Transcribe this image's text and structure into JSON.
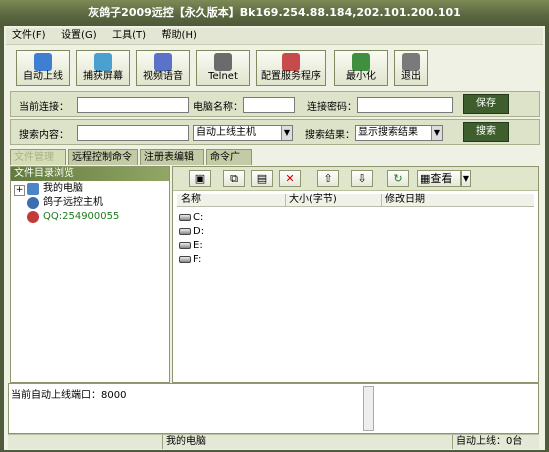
{
  "title": "灰鸽子2009远控【永久版本】Bk169.254.88.184,202.101.200.101",
  "menu": [
    "文件(F)",
    "设置(G)",
    "工具(T)",
    "帮助(H)"
  ],
  "toolbar": [
    {
      "label": "自动上线",
      "icon": "auto-online-icon",
      "color": "#3e7fd1"
    },
    {
      "label": "捕获屏幕",
      "icon": "capture-screen-icon",
      "color": "#4aa0cf"
    },
    {
      "label": "视频语音",
      "icon": "video-voice-icon",
      "color": "#5a73c8"
    },
    {
      "label": "Telnet",
      "icon": "telnet-icon",
      "color": "#6b6b6b"
    },
    {
      "label": "配置服务程序",
      "icon": "config-server-icon",
      "color": "#c84b4b"
    },
    {
      "label": "最小化",
      "icon": "minimize-icon",
      "color": "#3f8f3f"
    },
    {
      "label": "退出",
      "icon": "exit-icon",
      "color": "#7a7a7a"
    }
  ],
  "conn": {
    "current_label": "当前连接：",
    "current_value": "",
    "pc_label": "电脑名称：",
    "pc_value": "",
    "pwd_label": "连接密码：",
    "pwd_value": "",
    "save": "保存"
  },
  "search": {
    "content_label": "搜索内容：",
    "content_value": "",
    "mode": "自动上线主机",
    "result_label": "搜索结果：",
    "result_value": "显示搜索结果",
    "button": "搜索"
  },
  "tabs": [
    "文件管理器",
    "远程控制命令",
    "注册表编辑器",
    "命令广播"
  ],
  "tree": {
    "title": "文件目录浏览",
    "items": [
      {
        "label": "我的电脑",
        "icon": "computer-icon"
      },
      {
        "label": "鸽子远控主机",
        "icon": "host-icon"
      },
      {
        "label": "QQ:254900055",
        "icon": "qq-icon"
      }
    ]
  },
  "filebar": {
    "view": "查看"
  },
  "columns": [
    "名称",
    "大小(字节)",
    "修改日期"
  ],
  "drives": [
    "C:",
    "D:",
    "E:",
    "F:"
  ],
  "log": "当前自动上线端口：8000",
  "status": {
    "left": "",
    "center": "我的电脑",
    "right": "自动上线：0台"
  }
}
